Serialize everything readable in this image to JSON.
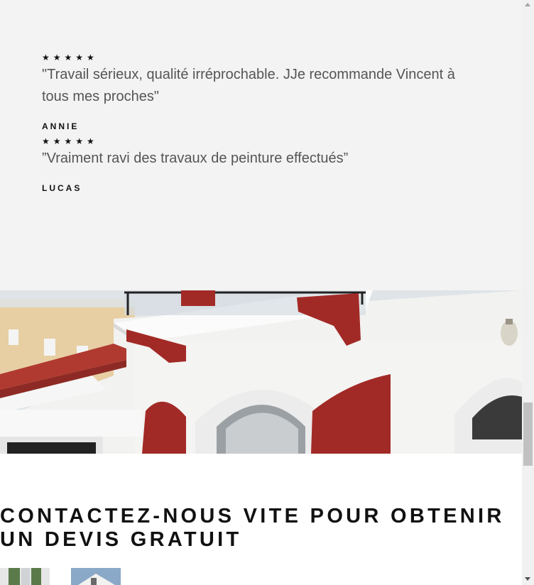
{
  "testimonials": [
    {
      "stars": "★★★★★",
      "rating": 5,
      "quote": "\"Travail sérieux, qualité irréprochable. JJe recommande Vincent à tous mes proches\"",
      "author": "ANNIE"
    },
    {
      "stars": "★★★★★",
      "rating": 5,
      "quote": "”Vraiment ravi des travaux de peinture effectués”",
      "author": "LUCAS"
    }
  ],
  "contact": {
    "title": "CONTACTEZ-NOUS VITE POUR OBTENIR UN DEVIS GRATUIT"
  },
  "colors": {
    "testimonial_bg": "#f3f3f3",
    "shutter_red": "#a22a26",
    "wall_white": "#f2f2f0"
  }
}
